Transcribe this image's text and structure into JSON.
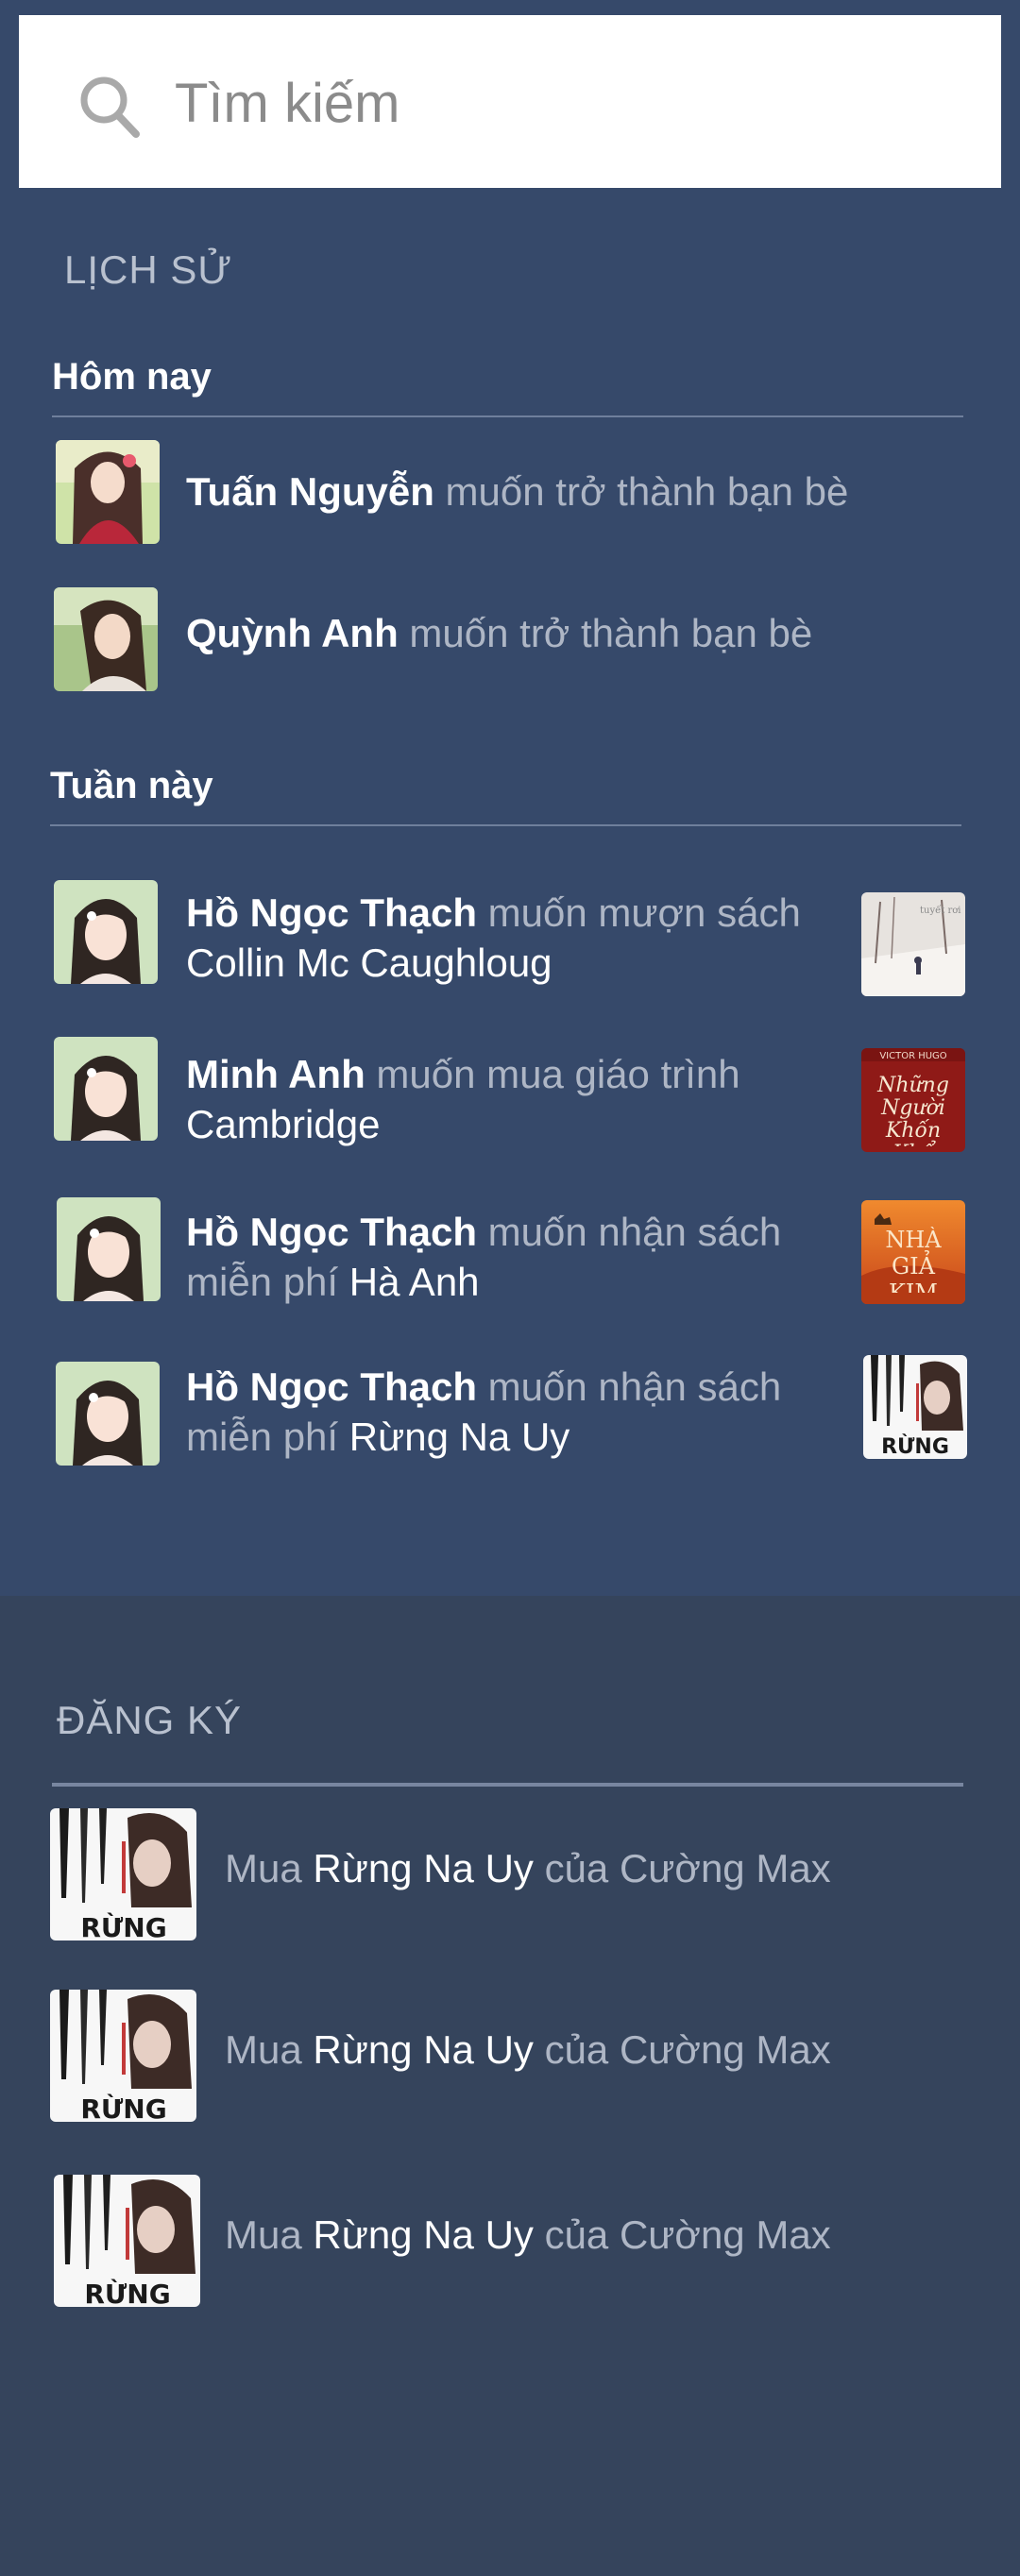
{
  "search": {
    "placeholder": "Tìm kiếm"
  },
  "history": {
    "title": "LỊCH SỬ",
    "today": {
      "header": "Hôm nay",
      "items": [
        {
          "name": "Tuấn Nguyễn",
          "action": " muốn trở thành bạn bè",
          "avatar": "avatar-girl-illustration"
        },
        {
          "name": "Quỳnh Anh",
          "action": " muốn trở thành bạn bè",
          "avatar": "avatar-girl-photo"
        }
      ]
    },
    "week": {
      "header": "Tuần này",
      "items": [
        {
          "name": "Hồ Ngọc Thạch",
          "action1": " muốn mượn sách",
          "action2": "",
          "book": "Collin Mc Caughloug",
          "thumb": "winter-book-cover"
        },
        {
          "name": "Minh Anh",
          "action1": " muốn mua giáo trình",
          "action2": "",
          "book": "Cambridge",
          "thumb": "nhung-nguoi-khon-kho-cover"
        },
        {
          "name": "Hồ Ngọc Thạch",
          "action1": " muốn nhận sách",
          "action2": "miễn phí ",
          "book": "Hà Anh",
          "thumb": "nha-gia-kim-cover"
        },
        {
          "name": "Hồ Ngọc Thạch",
          "action1": " muốn nhận sách",
          "action2": "miễn phí ",
          "book": "Rừng Na Uy",
          "thumb": "rung-na-uy-cover"
        }
      ],
      "thumb_texts": {
        "winter": "tuyết rơi",
        "victor": "VICTOR HUGO",
        "nguoi": "Những Người Khốn Khổ",
        "nha": "NHÀ GIẢ KIM",
        "rung": "RỪNG"
      }
    }
  },
  "register": {
    "title": "ĐĂNG KÝ",
    "items": [
      {
        "prefix": "Mua ",
        "book": "Rừng Na Uy",
        "suffix": " của Cường Max",
        "thumb_text": "RỪNG"
      },
      {
        "prefix": "Mua ",
        "book": "Rừng Na Uy",
        "suffix": " của Cường Max",
        "thumb_text": "RỪNG"
      },
      {
        "prefix": "Mua ",
        "book": "Rừng Na Uy",
        "suffix": " của Cường Max",
        "thumb_text": "RỪNG"
      }
    ]
  },
  "colors": {
    "background": "#36496a",
    "register_background": "#35445c",
    "text_primary": "#ffffff",
    "text_secondary": "#aeb6c5"
  }
}
